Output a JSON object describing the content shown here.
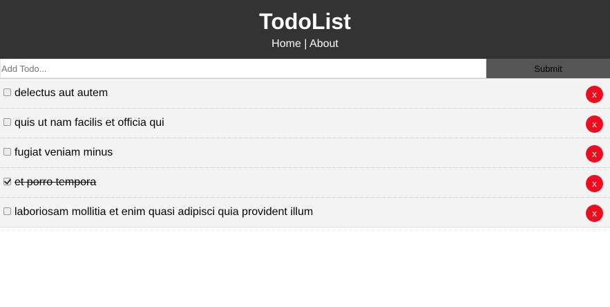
{
  "header": {
    "title": "TodoList",
    "nav": {
      "home": "Home",
      "separator": " | ",
      "about": "About"
    }
  },
  "add_form": {
    "placeholder": "Add Todo...",
    "submit_label": "Submit"
  },
  "todos": [
    {
      "title": "delectus aut autem",
      "completed": false,
      "delete_label": "x"
    },
    {
      "title": "quis ut nam facilis et officia qui",
      "completed": false,
      "delete_label": "x"
    },
    {
      "title": "fugiat veniam minus",
      "completed": false,
      "delete_label": "x"
    },
    {
      "title": "et porro tempora",
      "completed": true,
      "delete_label": "x"
    },
    {
      "title": "laboriosam mollitia et enim quasi adipisci quia provident illum",
      "completed": false,
      "delete_label": "x"
    }
  ],
  "colors": {
    "header_bg": "#333333",
    "submit_bg": "#555555",
    "item_bg": "#f4f4f4",
    "delete_bg": "#ee0d1f"
  }
}
